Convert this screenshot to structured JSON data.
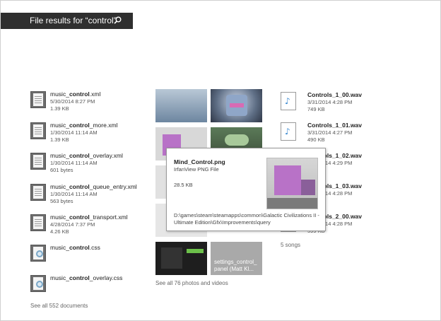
{
  "header": {
    "title": "File results for “control”",
    "search_icon": "search-icon"
  },
  "documents": [
    {
      "prefix": "music_",
      "match": "control",
      "suffix": ".xml",
      "date": "5/30/2014 8:27 PM",
      "size": "1.39 KB",
      "icon": "xml-file-icon"
    },
    {
      "prefix": "music_",
      "match": "control",
      "suffix": "_more.xml",
      "date": "1/30/2014 11:14 AM",
      "size": "1.39 KB",
      "icon": "xml-file-icon"
    },
    {
      "prefix": "music_",
      "match": "control",
      "suffix": "_overlay.xml",
      "date": "1/30/2014 11:14 AM",
      "size": "601 bytes",
      "icon": "xml-file-icon"
    },
    {
      "prefix": "music_",
      "match": "control",
      "suffix": "_queue_entry.xml",
      "date": "1/30/2014 11:14 AM",
      "size": "563 bytes",
      "icon": "xml-file-icon"
    },
    {
      "prefix": "music_",
      "match": "control",
      "suffix": "_transport.xml",
      "date": "4/28/2014 7:37 PM",
      "size": "4.26 KB",
      "icon": "xml-file-icon"
    },
    {
      "prefix": "music_",
      "match": "control",
      "suffix": ".css",
      "date": "",
      "size": "",
      "icon": "css-file-icon"
    },
    {
      "prefix": "music_",
      "match": "control",
      "suffix": "_overlay.css",
      "date": "",
      "size": "",
      "icon": "css-file-icon"
    }
  ],
  "documents_see_all": "See all 552 documents",
  "photos": {
    "settings_caption": "settings_control_\npanel (Matt Kl...",
    "see_all": "See all 76 photos and videos"
  },
  "songs": [
    {
      "name": "Controls_1_00.wav",
      "date": "3/31/2014 4:28 PM",
      "size": "749 KB",
      "icon": "music-note-icon"
    },
    {
      "name": "Controls_1_01.wav",
      "date": "3/31/2014 4:27 PM",
      "size": "490 KB",
      "icon": "music-note-icon"
    },
    {
      "name": "Controls_1_02.wav",
      "date": "3/31/2014 4:29 PM",
      "size": "",
      "icon": "music-note-icon"
    },
    {
      "name": "Controls_1_03.wav",
      "date": "3/31/2014 4:28 PM",
      "size": "",
      "icon": "music-note-icon"
    },
    {
      "name": "Controls_2_00.wav",
      "date": "3/31/2014 4:28 PM",
      "size": "599 KB",
      "icon": "music-note-icon"
    }
  ],
  "songs_see_all": "5 songs",
  "tooltip": {
    "title": "Mind_Control.png",
    "type": "IrfanView PNG File",
    "size": "28.5 KB",
    "path": "D:\\games\\steam\\steamapps\\common\\Galactic Civilizations II - Ultimate Edition\\Gfx\\Improvements\\query"
  },
  "colors": {
    "header_bg": "#2f2f2f",
    "accent": "#3b8ad1"
  }
}
